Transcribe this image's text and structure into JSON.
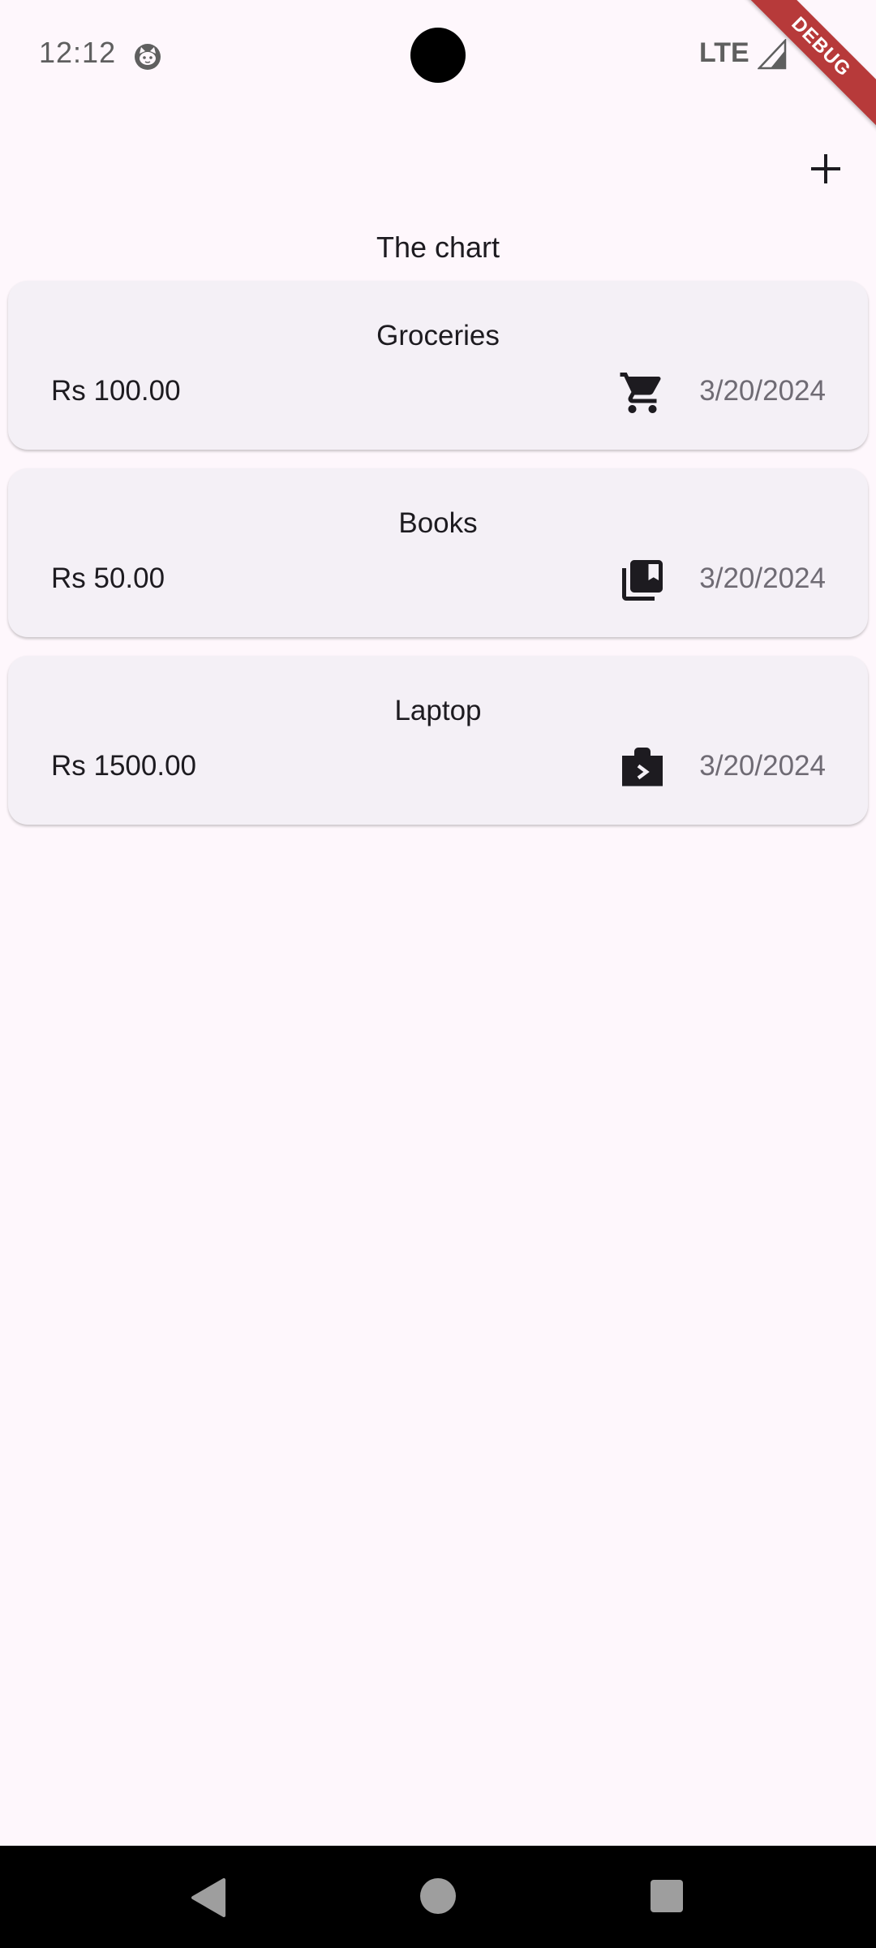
{
  "status_bar": {
    "time": "12:12",
    "network": "LTE",
    "notification_icon": "cat-face-icon",
    "signal_icon": "cell-signal-icon"
  },
  "debug_banner": "DEBUG",
  "app_bar": {
    "add_icon": "plus-icon"
  },
  "page": {
    "title": "The chart"
  },
  "colors": {
    "background": "#fef7fc",
    "card": "#f4f0f6",
    "ribbon": "#b73a3a",
    "date_text": "#6f6b74"
  },
  "expenses": [
    {
      "title": "Groceries",
      "amount": "Rs 100.00",
      "date": "3/20/2024",
      "icon": "shopping-cart-icon"
    },
    {
      "title": "Books",
      "amount": "Rs 50.00",
      "date": "3/20/2024",
      "icon": "library-books-icon"
    },
    {
      "title": "Laptop",
      "amount": "Rs 1500.00",
      "date": "3/20/2024",
      "icon": "work-briefcase-icon"
    }
  ],
  "nav_bar": {
    "back_icon": "back-triangle-icon",
    "home_icon": "home-circle-icon",
    "recents_icon": "recents-square-icon"
  }
}
